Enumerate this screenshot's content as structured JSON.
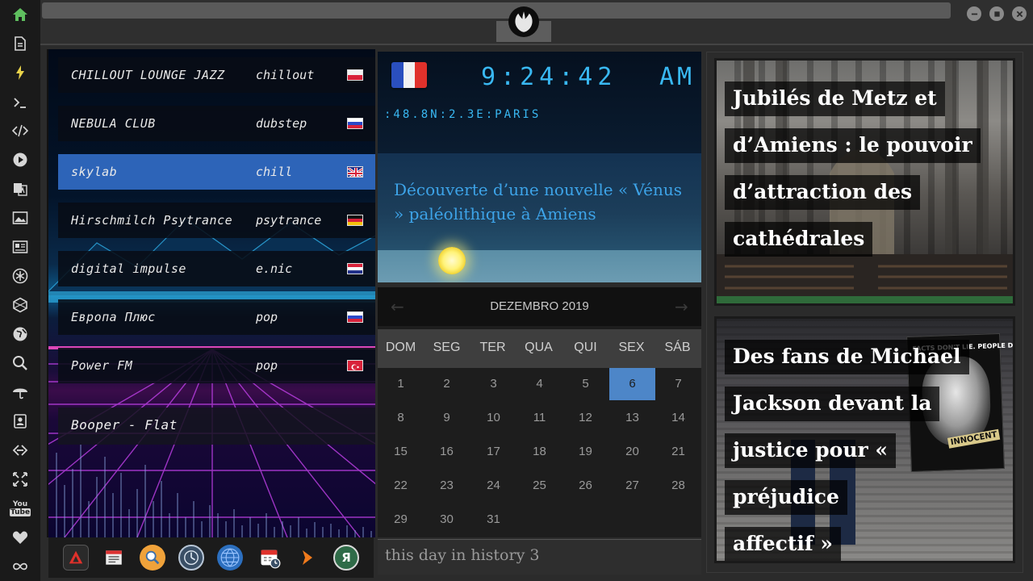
{
  "colors": {
    "accent": "#39b8f2",
    "selected_station": "#2d64b8",
    "today": "#4d86c8",
    "home_icon": "#5fbf5f"
  },
  "sidebar": {
    "icons": [
      "home-icon",
      "document-icon",
      "bolt-icon",
      "terminal-icon",
      "code-icon",
      "play-icon",
      "translate-icon",
      "image-icon",
      "news-icon",
      "asterisk-icon",
      "hexagon-icon",
      "globe-icon",
      "search-icon",
      "umbrella-icon",
      "contacts-icon",
      "link-icon",
      "expand-icon",
      "youtube-icon",
      "heart-icon",
      "infinity-icon"
    ]
  },
  "window": {
    "emblem": "rebel-alliance-emblem",
    "controls": [
      "minimize-icon",
      "maximize-icon",
      "close-icon"
    ]
  },
  "radio": {
    "stations": [
      {
        "name": "CHILLOUT LOUNGE JAZZ",
        "genre": "chillout",
        "flag": "pl"
      },
      {
        "name": "NEBULA CLUB",
        "genre": "dubstep",
        "flag": "ru"
      },
      {
        "name": "skylab",
        "genre": "chill",
        "flag": "gb"
      },
      {
        "name": "Hirschmilch Psytrance",
        "genre": "psytrance",
        "flag": "de"
      },
      {
        "name": "digital impulse",
        "genre": "e.nic",
        "flag": "hr"
      },
      {
        "name": "Европа Плюс",
        "genre": "pop",
        "flag": "ru"
      },
      {
        "name": "Power FM",
        "genre": "pop",
        "flag": "tr"
      }
    ],
    "selected_index": 2,
    "now_playing": "Booper - Flat"
  },
  "dock": {
    "icons": [
      "autodesk-icon",
      "calendar-news-icon",
      "magnifier-icon",
      "clock-icon",
      "globe-icon",
      "calendar-icon",
      "arrow-icon",
      "yandex-icon"
    ]
  },
  "clock": {
    "time": "9:24:42",
    "ampm": "AM",
    "location": ":48.8N:2.3E:PARIS",
    "flag": "fr",
    "headline": "Découverte d’une nouvelle « Vénus » paléolithique à Amiens"
  },
  "calendar": {
    "month_label": "DEZEMBRO 2019",
    "weekdays": [
      "DOM",
      "SEG",
      "TER",
      "QUA",
      "QUI",
      "SEX",
      "SÁB"
    ],
    "days": [
      "1",
      "2",
      "3",
      "4",
      "5",
      "6",
      "7",
      "8",
      "9",
      "10",
      "11",
      "12",
      "13",
      "14",
      "15",
      "16",
      "17",
      "18",
      "19",
      "20",
      "21",
      "22",
      "23",
      "24",
      "25",
      "26",
      "27",
      "28",
      "29",
      "30",
      "31"
    ],
    "first_weekday_index": 0,
    "today": "6",
    "history_label": "this day in history 3"
  },
  "news": {
    "items": [
      {
        "headline_lines": [
          "Jubilés de Metz et",
          "d’Amiens : le pouvoir",
          "d’attraction des",
          "cathédrales"
        ]
      },
      {
        "headline_lines": [
          "Des fans de Michael",
          "Jackson devant la",
          "justice pour « préjudice",
          "affectif »"
        ],
        "poster_top": "FACTS DON'T LIE. PEOPLE DO.",
        "poster_label": "INNOCENT"
      }
    ]
  }
}
